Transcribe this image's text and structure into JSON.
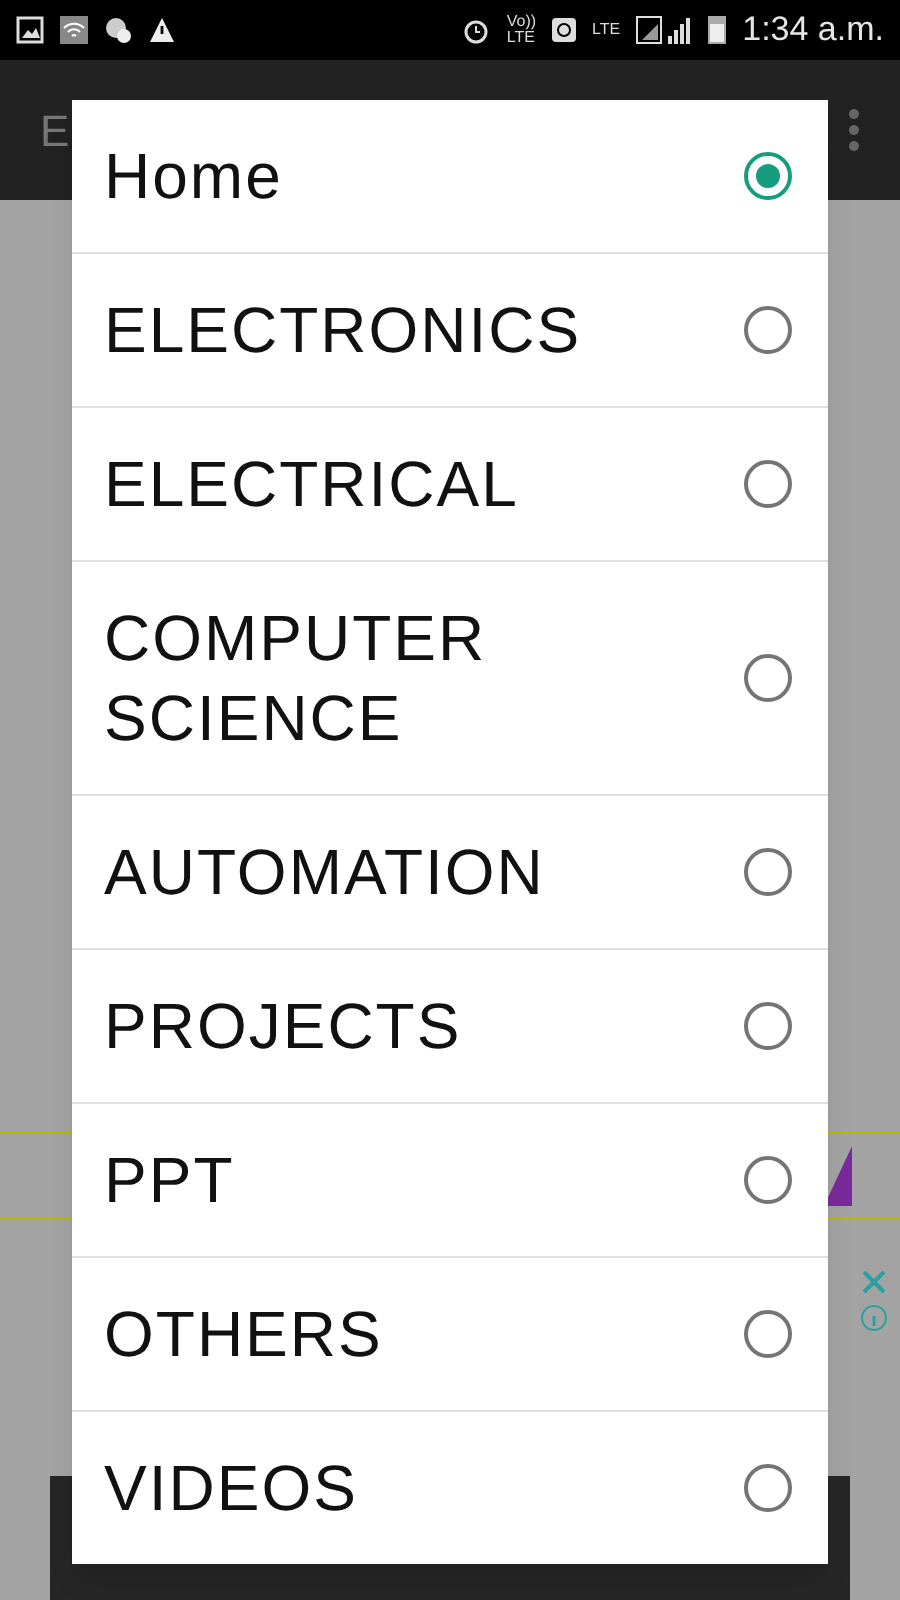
{
  "status_bar": {
    "network_labels": [
      "Vo))",
      "LTE",
      "LTE"
    ],
    "time": "1:34 a.m."
  },
  "app_bar": {
    "title": "E"
  },
  "dialog": {
    "options": [
      {
        "label": "Home",
        "selected": true
      },
      {
        "label": "ELECTRONICS",
        "selected": false
      },
      {
        "label": "ELECTRICAL",
        "selected": false
      },
      {
        "label": "COMPUTER SCIENCE",
        "selected": false
      },
      {
        "label": "AUTOMATION",
        "selected": false
      },
      {
        "label": "PROJECTS",
        "selected": false
      },
      {
        "label": "PPT",
        "selected": false
      },
      {
        "label": "OTHERS",
        "selected": false
      },
      {
        "label": "VIDEOS",
        "selected": false
      }
    ]
  }
}
